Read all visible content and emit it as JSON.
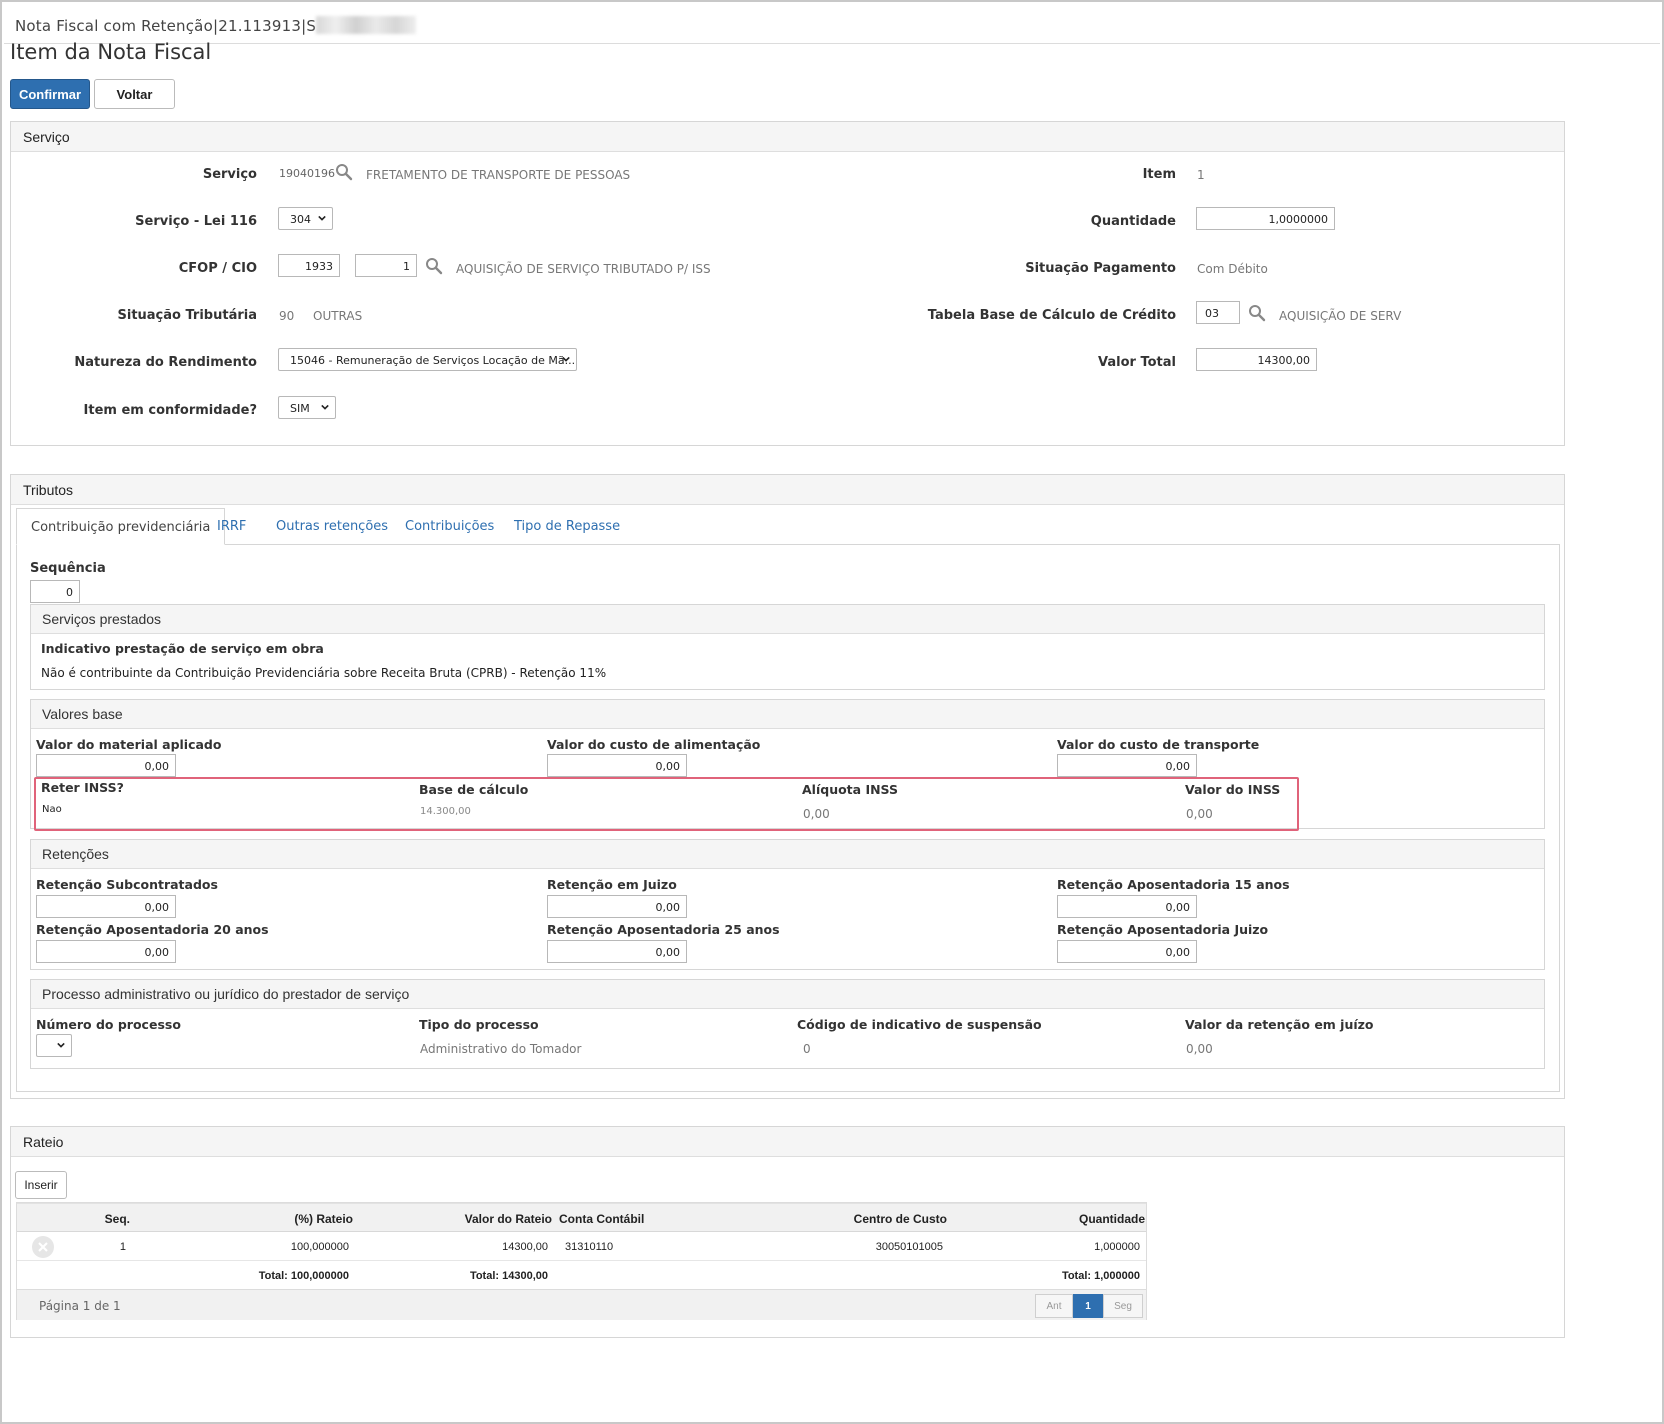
{
  "window": {
    "title": "Nota Fiscal com Retenção|21.113913|S"
  },
  "page": {
    "title": "Item da Nota Fiscal"
  },
  "toolbar": {
    "confirm_label": "Confirmar",
    "back_label": "Voltar"
  },
  "servico": {
    "header": "Serviço",
    "servico_label": "Serviço",
    "servico_code": "19040196",
    "servico_desc": "FRETAMENTO DE TRANSPORTE DE PESSOAS",
    "lei116_label": "Serviço - Lei 116",
    "lei116_value": "304",
    "cfop_label": "CFOP / CIO",
    "cfop_value": "1933",
    "cio_value": "1",
    "cfop_desc": "AQUISIÇÃO DE SERVIÇO TRIBUTADO P/ ISS",
    "sit_trib_label": "Situação Tributária",
    "sit_trib_code": "90",
    "sit_trib_desc": "OUTRAS",
    "natureza_label": "Natureza do Rendimento",
    "natureza_value": "15046 - Remuneração de Serviços Locação de Mã...",
    "conformidade_label": "Item em conformidade?",
    "conformidade_value": "SIM",
    "item_label": "Item",
    "item_value": "1",
    "quantidade_label": "Quantidade",
    "quantidade_value": "1,0000000",
    "sit_pag_label": "Situação Pagamento",
    "sit_pag_value": "Com Débito",
    "tabela_label": "Tabela Base de Cálculo de Crédito",
    "tabela_value": "03",
    "tabela_desc": "AQUISIÇÃO DE SERV",
    "valor_total_label": "Valor Total",
    "valor_total_value": "14300,00"
  },
  "tributos": {
    "header": "Tributos",
    "tabs": [
      {
        "label": "Contribuição previdenciária"
      },
      {
        "label": "IRRF"
      },
      {
        "label": "Outras retenções"
      },
      {
        "label": "Contribuições"
      },
      {
        "label": "Tipo de Repasse"
      }
    ],
    "sequencia_label": "Sequência",
    "sequencia_value": "0",
    "servicos_prestados": {
      "header": "Serviços prestados",
      "indicativo_label": "Indicativo prestação de serviço em obra",
      "cprb_text": "Não é contribuinte da Contribuição Previdenciária sobre Receita Bruta (CPRB) - Retenção 11%"
    },
    "valores_base": {
      "header": "Valores base",
      "material_label": "Valor do material aplicado",
      "material_value": "0,00",
      "alimentacao_label": "Valor do custo de alimentação",
      "alimentacao_value": "0,00",
      "transporte_label": "Valor do custo de transporte",
      "transporte_value": "0,00",
      "reter_label": "Reter INSS?",
      "reter_value": "Nao",
      "base_label": "Base de cálculo",
      "base_value": "14.300,00",
      "aliquota_label": "Alíquota INSS",
      "aliquota_value": "0,00",
      "valor_inss_label": "Valor do INSS",
      "valor_inss_value": "0,00"
    },
    "retencoes": {
      "header": "Retenções",
      "subcontratados_label": "Retenção Subcontratados",
      "subcontratados_value": "0,00",
      "juizo_label": "Retenção em Juizo",
      "juizo_value": "0,00",
      "apos15_label": "Retenção Aposentadoria 15 anos",
      "apos15_value": "0,00",
      "apos20_label": "Retenção Aposentadoria 20 anos",
      "apos20_value": "0,00",
      "apos25_label": "Retenção Aposentadoria 25 anos",
      "apos25_value": "0,00",
      "aposjuizo_label": "Retenção Aposentadoria Juizo",
      "aposjuizo_value": "0,00"
    },
    "processo": {
      "header": "Processo administrativo ou jurídico do prestador de serviço",
      "numero_label": "Número do processo",
      "tipo_label": "Tipo do processo",
      "tipo_value": "Administrativo do Tomador",
      "codigo_label": "Código de indicativo de suspensão",
      "codigo_value": "0",
      "valor_label": "Valor da retenção em juízo",
      "valor_value": "0,00"
    }
  },
  "rateio": {
    "header": "Rateio",
    "insert_label": "Inserir",
    "columns": [
      "Seq.",
      "(%) Rateio",
      "Valor do Rateio",
      "Conta Contábil",
      "Centro de Custo",
      "Quantidade"
    ],
    "rows": [
      {
        "seq": "1",
        "rateio": "100,000000",
        "valor": "14300,00",
        "conta": "31310110",
        "centro": "30050101005",
        "quantidade": "1,000000"
      }
    ],
    "totals": {
      "rateio": "Total: 100,000000",
      "valor": "Total: 14300,00",
      "quantidade": "Total: 1,000000"
    },
    "pagination": {
      "info": "Página 1 de 1",
      "prev": "Ant",
      "current": "1",
      "next": "Seg"
    }
  }
}
